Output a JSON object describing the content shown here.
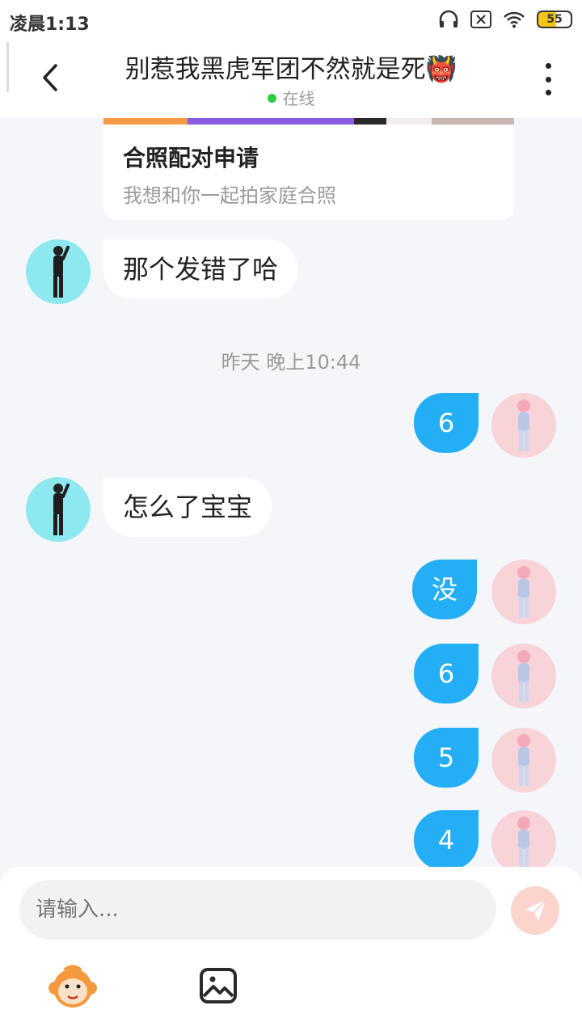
{
  "status": {
    "time": "凌晨1:13",
    "battery": "55"
  },
  "header": {
    "title": "别惹我黑虎军团不然就是死👹",
    "online": "在线"
  },
  "card": {
    "title": "合照配对申请",
    "subtitle": "我想和你一起拍家庭合照"
  },
  "messages": [
    {
      "side": "left",
      "text": "那个发错了哈"
    },
    {
      "side": "right",
      "text": "6"
    },
    {
      "side": "left",
      "text": "怎么了宝宝"
    },
    {
      "side": "right",
      "text": "没"
    },
    {
      "side": "right",
      "text": "6"
    },
    {
      "side": "right",
      "text": "5"
    },
    {
      "side": "right",
      "text": "4"
    }
  ],
  "timestamp": "昨天 晚上10:44",
  "input": {
    "placeholder": "请输入..."
  },
  "colors": {
    "accent": "#23aef5",
    "send_button": "#fbd4ce"
  }
}
